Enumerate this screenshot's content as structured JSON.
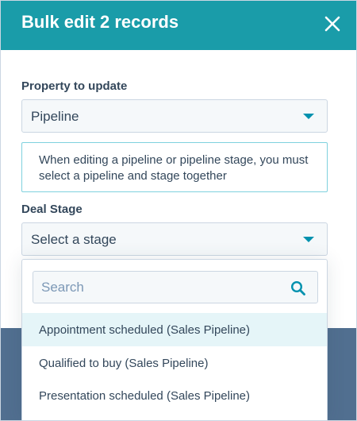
{
  "modal": {
    "title": "Bulk edit 2 records",
    "close_icon": "close-icon"
  },
  "property": {
    "label": "Property to update",
    "selected": "Pipeline"
  },
  "info": {
    "text": "When editing a pipeline or pipeline stage, you must select a pipeline and stage together"
  },
  "deal_stage": {
    "label": "Deal Stage",
    "placeholder": "Select a stage"
  },
  "dropdown": {
    "search_placeholder": "Search",
    "search_icon": "search-icon",
    "options": [
      {
        "label": "Appointment scheduled (Sales Pipeline)",
        "highlighted": true
      },
      {
        "label": "Qualified to buy (Sales Pipeline)",
        "highlighted": false
      },
      {
        "label": "Presentation scheduled (Sales Pipeline)",
        "highlighted": false
      }
    ]
  },
  "colors": {
    "header": "#1a9ca9",
    "accent": "#0091ae",
    "highlight": "#e5f5f8",
    "text": "#33475b"
  }
}
